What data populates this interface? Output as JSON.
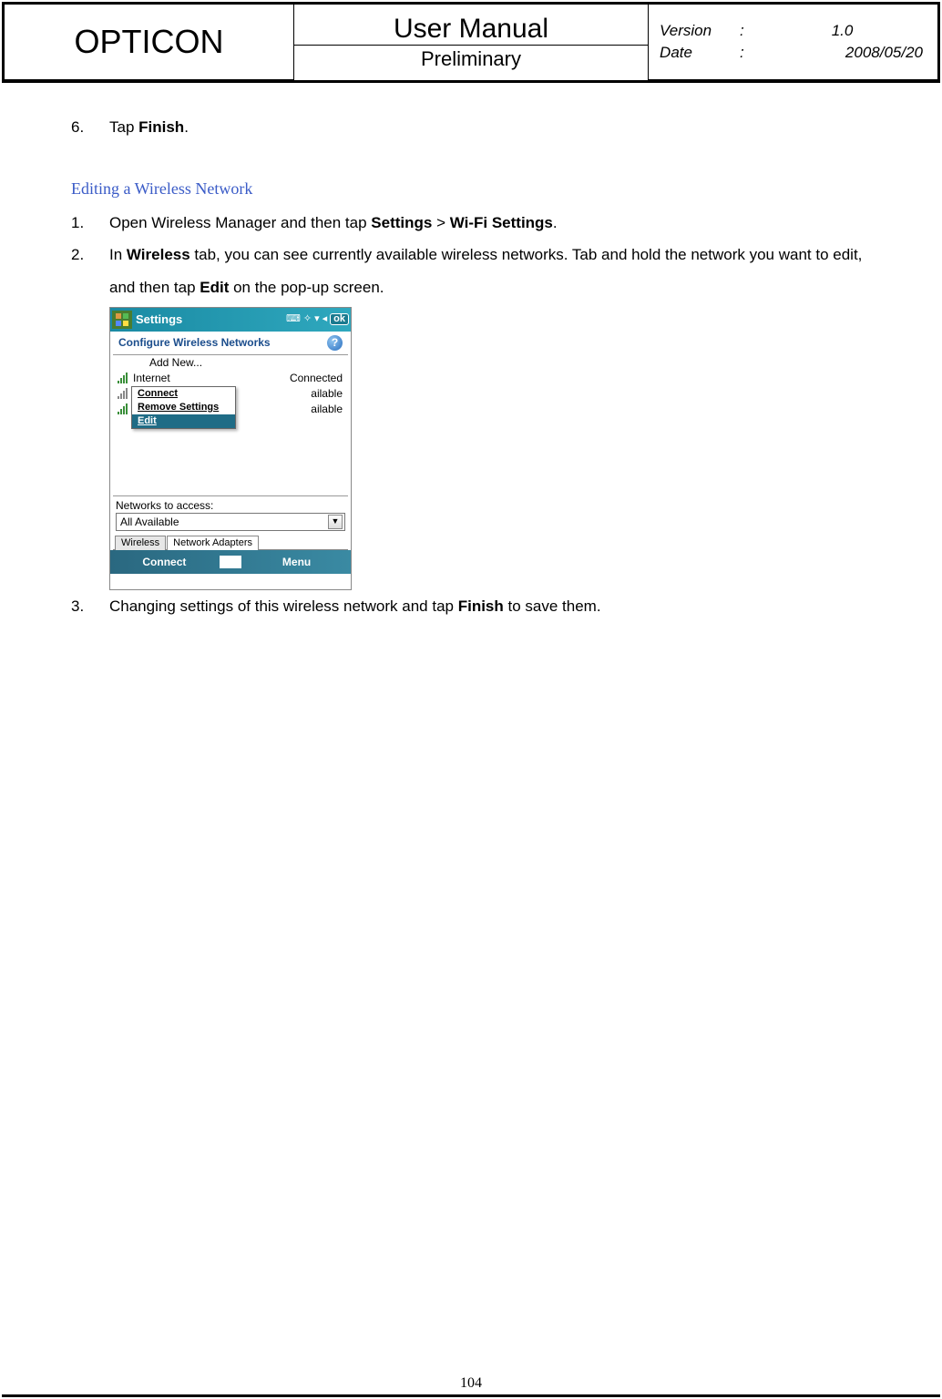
{
  "header": {
    "company": "OPTICON",
    "title": "User Manual",
    "subtitle": "Preliminary",
    "version_label": "Version",
    "version_value": "1.0",
    "date_label": "Date",
    "date_value": "2008/05/20",
    "separator": ":"
  },
  "step6": {
    "num": "6.",
    "prefix": "Tap ",
    "bold": "Finish",
    "suffix": "."
  },
  "section_title": "Editing a Wireless Network",
  "steps": [
    {
      "num": "1.",
      "parts": [
        "Open Wireless Manager and then tap ",
        "Settings",
        " > ",
        "Wi-Fi Settings",
        "."
      ]
    },
    {
      "num": "2.",
      "parts": [
        "In ",
        "Wireless",
        " tab, you can see currently available wireless networks. Tab and hold the network you want to edit, and then tap ",
        "Edit",
        " on the pop-up screen."
      ]
    },
    {
      "num": "3.",
      "parts": [
        "Changing settings of this wireless network and tap ",
        "Finish",
        " to save them."
      ]
    }
  ],
  "screenshot": {
    "titlebar": "Settings",
    "ok": "ok",
    "subbar": "Configure Wireless Networks",
    "help": "?",
    "networks": {
      "addnew": "Add New...",
      "row1_name": "Internet",
      "row1_status": "Connected",
      "row2_status": "ailable",
      "row3_status": "ailable"
    },
    "context": {
      "connect": "Connect",
      "remove": "Remove Settings",
      "edit": "Edit"
    },
    "access_label": "Networks to access:",
    "dropdown": "All Available",
    "tabs": {
      "wireless": "Wireless",
      "adapters": "Network Adapters"
    },
    "bottom": {
      "connect": "Connect",
      "menu": "Menu"
    }
  },
  "page_number": "104"
}
